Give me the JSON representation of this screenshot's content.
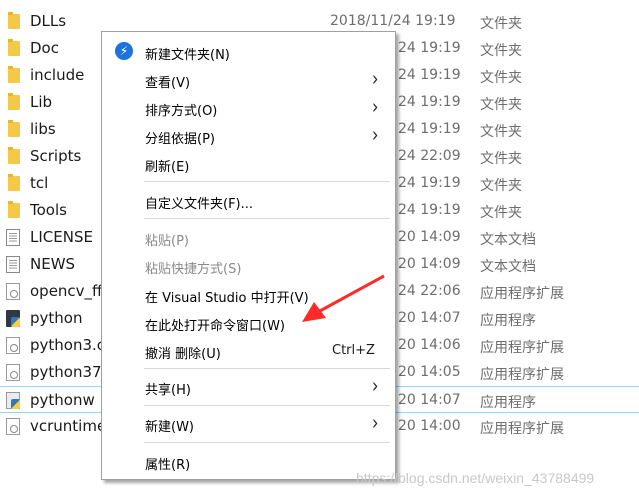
{
  "files": [
    {
      "name": "DLLs",
      "date": "2018/11/24 19:19",
      "type": "文件夹",
      "icon": "folder"
    },
    {
      "name": "Doc",
      "date": "24 19:19",
      "type": "文件夹",
      "icon": "folder"
    },
    {
      "name": "include",
      "date": "24 19:19",
      "type": "文件夹",
      "icon": "folder"
    },
    {
      "name": "Lib",
      "date": "24 19:19",
      "type": "文件夹",
      "icon": "folder"
    },
    {
      "name": "libs",
      "date": "24 19:19",
      "type": "文件夹",
      "icon": "folder"
    },
    {
      "name": "Scripts",
      "date": "24 22:09",
      "type": "文件夹",
      "icon": "folder"
    },
    {
      "name": "tcl",
      "date": "24 19:19",
      "type": "文件夹",
      "icon": "folder"
    },
    {
      "name": "Tools",
      "date": "24 19:19",
      "type": "文件夹",
      "icon": "folder"
    },
    {
      "name": "LICENSE",
      "date": "20 14:09",
      "type": "文本文档",
      "icon": "doc"
    },
    {
      "name": "NEWS",
      "date": "20 14:09",
      "type": "文本文档",
      "icon": "doc"
    },
    {
      "name": "opencv_ff",
      "date": "24 22:06",
      "type": "应用程序扩展",
      "icon": "dll"
    },
    {
      "name": "python",
      "date": "20 14:07",
      "type": "应用程序",
      "icon": "py"
    },
    {
      "name": "python3.c",
      "date": "20 14:06",
      "type": "应用程序扩展",
      "icon": "dll"
    },
    {
      "name": "python37.",
      "date": "20 14:05",
      "type": "应用程序扩展",
      "icon": "dll"
    },
    {
      "name": "pythonw",
      "date": "20 14:07",
      "type": "应用程序",
      "icon": "pyw",
      "selected": true
    },
    {
      "name": "vcruntime",
      "date": "20 14:00",
      "type": "应用程序扩展",
      "icon": "dll"
    }
  ],
  "menu": {
    "items": [
      {
        "label": "新建文件夹(N)",
        "icon": "bolt-icon"
      },
      {
        "label": "查看(V)",
        "submenu": true
      },
      {
        "label": "排序方式(O)",
        "submenu": true
      },
      {
        "label": "分组依据(P)",
        "submenu": true
      },
      {
        "label": "刷新(E)"
      },
      {
        "label": "自定义文件夹(F)..."
      },
      {
        "label": "粘贴(P)",
        "disabled": true
      },
      {
        "label": "粘贴快捷方式(S)",
        "disabled": true
      },
      {
        "label": "在 Visual Studio 中打开(V)"
      },
      {
        "label": "在此处打开命令窗口(W)"
      },
      {
        "label": "撤消 删除(U)",
        "shortcut": "Ctrl+Z"
      },
      {
        "label": "共享(H)",
        "submenu": true
      },
      {
        "label": "新建(W)",
        "submenu": true
      },
      {
        "label": "属性(R)"
      }
    ],
    "arrow_glyph": "›"
  },
  "annotation_color": "#ff2a2a",
  "watermark": "https://blog.csdn.net/weixin_43788499"
}
